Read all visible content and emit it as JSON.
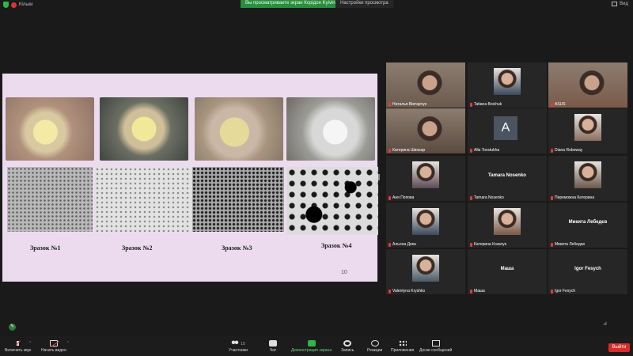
{
  "topbar": {
    "app_label": "Кільки",
    "banner": "Вы просматриваете экран Корідон Kyivina",
    "view_options": "Настройки просмотра",
    "view_label": "Вид"
  },
  "slide": {
    "labels": [
      "Зразок №1",
      "Зразок №2",
      "Зразок №3",
      "Зразок №4"
    ],
    "page_number": "10"
  },
  "participants": [
    {
      "name": "Наталья Вівтарчук",
      "video": true
    },
    {
      "name": "Tatiana Boichuk",
      "video": true
    },
    {
      "name": "ASUS",
      "video": true
    },
    {
      "name": "Катерина Шинкар",
      "video": true,
      "active": true
    },
    {
      "name": "Alla Tovstukha",
      "video": false,
      "avatar": "A"
    },
    {
      "name": "Diana Roboway",
      "video": true
    },
    {
      "name": "Аня Попова",
      "video": true
    },
    {
      "name": "Tamara Nosenko",
      "video": false,
      "big": "Tamara Nosenko"
    },
    {
      "name": "Переможна Катерина",
      "video": true
    },
    {
      "name": "Альона Дика",
      "video": true
    },
    {
      "name": "Катерина Козачук",
      "video": true
    },
    {
      "name": "Микита Лебедєв",
      "video": false,
      "big": "Микита Лебедєв"
    },
    {
      "name": "Valentyna Kryshko",
      "video": true
    },
    {
      "name": "Маша",
      "video": false,
      "big": "Маша"
    },
    {
      "name": "Igor Fesych",
      "video": false,
      "big": "Igor Fesych"
    }
  ],
  "toolbar": {
    "mute": "Включить звук",
    "video": "Начать видео",
    "participants": "Участники",
    "participant_count": "15",
    "chat": "Чат",
    "share": "Демонстрация экрана",
    "record": "Запись",
    "reactions": "Реакции",
    "apps": "Приложения",
    "whiteboards": "Доски сообщений",
    "leave": "Выйти"
  },
  "colors": {
    "share_green": "#2fb54a",
    "leave_red": "#d92d2d",
    "active_border": "#c8e23a"
  }
}
